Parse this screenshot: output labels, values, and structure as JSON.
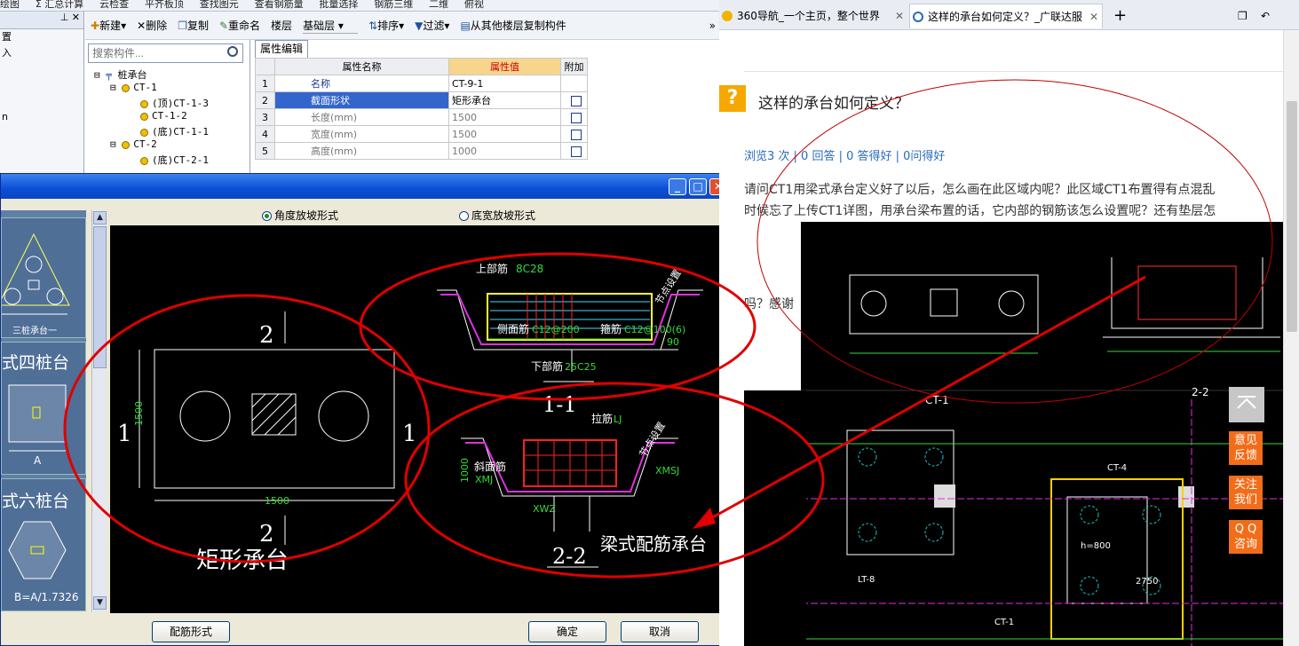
{
  "app": {
    "top_items": [
      "绘图",
      "Σ 汇总计算",
      "云检查",
      "平齐板顶",
      "查找图元",
      "查看钢筋量",
      "批量选择",
      "钢筋三维",
      "二维",
      "俯视"
    ],
    "left_strip": {
      "items": [
        "置",
        "入",
        "",
        "",
        "",
        "n"
      ]
    },
    "toolbar": {
      "new": "新建",
      "delete": "删除",
      "copy": "复制",
      "rename": "重命名",
      "floor": "楼层",
      "floor_value": "基础层",
      "sort": "排序",
      "filter": "过滤",
      "copy_from": "从其他楼层复制构件",
      "more": "»"
    },
    "search_placeholder": "搜索构件...",
    "tree": [
      {
        "label": "桩承台",
        "level": 0
      },
      {
        "label": "CT-1",
        "level": 1
      },
      {
        "label": "(顶)CT-1-3",
        "level": 2
      },
      {
        "label": "CT-1-2",
        "level": 2
      },
      {
        "label": "(底)CT-1-1",
        "level": 2
      },
      {
        "label": "CT-2",
        "level": 1
      },
      {
        "label": "(底)CT-2-1",
        "level": 2
      }
    ],
    "props": {
      "tab": "属性编辑",
      "headers": {
        "name": "属性名称",
        "value": "属性值",
        "extra": "附加"
      },
      "rows": [
        {
          "no": "1",
          "name": "名称",
          "value": "CT-9-1",
          "check": false
        },
        {
          "no": "2",
          "name": "截面形状",
          "value": "矩形承台",
          "check": true
        },
        {
          "no": "3",
          "name": "长度(mm)",
          "value": "1500",
          "check": true
        },
        {
          "no": "4",
          "name": "宽度(mm)",
          "value": "1500",
          "check": true
        },
        {
          "no": "5",
          "name": "高度(mm)",
          "value": "1000",
          "check": true
        }
      ]
    }
  },
  "dialog": {
    "radio1": "角度放坡形式",
    "radio2": "底宽放坡形式",
    "gallery": {
      "c1": "三桩承台一",
      "c2": "式四桩台",
      "c3": "式六桩台",
      "a_label": "A",
      "b_label": "B=A/1.7326"
    },
    "buttons": {
      "config": "配筋形式",
      "ok": "确定",
      "cancel": "取消"
    },
    "cad": {
      "rect_title": "矩形承台",
      "beam_title": "梁式配筋承台",
      "sec11": "1-1",
      "sec22": "2-2",
      "label1": "1",
      "label2": "2",
      "dim1500": "1500",
      "dim1500v": "1500",
      "top_bar": "上部筋",
      "top_bar_val": "8C28",
      "side_bar": "侧面筋",
      "side_bar_val": "C12@200",
      "stirrup": "箍筋",
      "stirrup_val": "C12@100(6)",
      "bottom_bar": "下部筋",
      "bottom_bar_val": "25C25",
      "tie": "拉筋",
      "tie_val": "LJ",
      "slope_bar": "斜面筋",
      "xmj": "XMJ",
      "xmsj": "XMSJ",
      "xwz": "XWZ",
      "dim1000": "1000",
      "angle": "90",
      "node1": "节点设置",
      "node2": "节点设置"
    }
  },
  "browser": {
    "tab1": "360导航_一个主页，整个世界",
    "tab2": "这样的承台如何定义？_广联达服",
    "add": "+",
    "question_badge": "?",
    "title": "这样的承台如何定义？",
    "stats": "浏览3 次 | 0 回答 | 0 答得好 | 0问得好",
    "body_line1": "请问CT1用梁式承台定义好了以后，怎么画在此区域内呢？此区域CT1布置得有点混乱",
    "body_line2": "时候忘了上传CT1详图，用承台梁布置的话，它内部的钢筋该怎么设置呢？还有垫层怎",
    "body_line3": "吗？感谢",
    "side_buttons": {
      "feedback": "意见\n反馈",
      "follow": "关注\n我们",
      "qq": "Q Q\n咨询"
    },
    "drawing": {
      "ct1": "CT-1",
      "s22": "2-2",
      "h": "h=800",
      "ct4": "CT-4",
      "lt": "LT-8",
      "d2750": "2750",
      "ct1b": "CT-1"
    }
  },
  "colors": {
    "annotation": "#e00000",
    "cad_line": "#ffffff",
    "cad_dim": "#33dd33",
    "cad_rebar_red": "#ff2020",
    "cad_magenta": "#e030e0",
    "link": "#2a6bb8"
  }
}
